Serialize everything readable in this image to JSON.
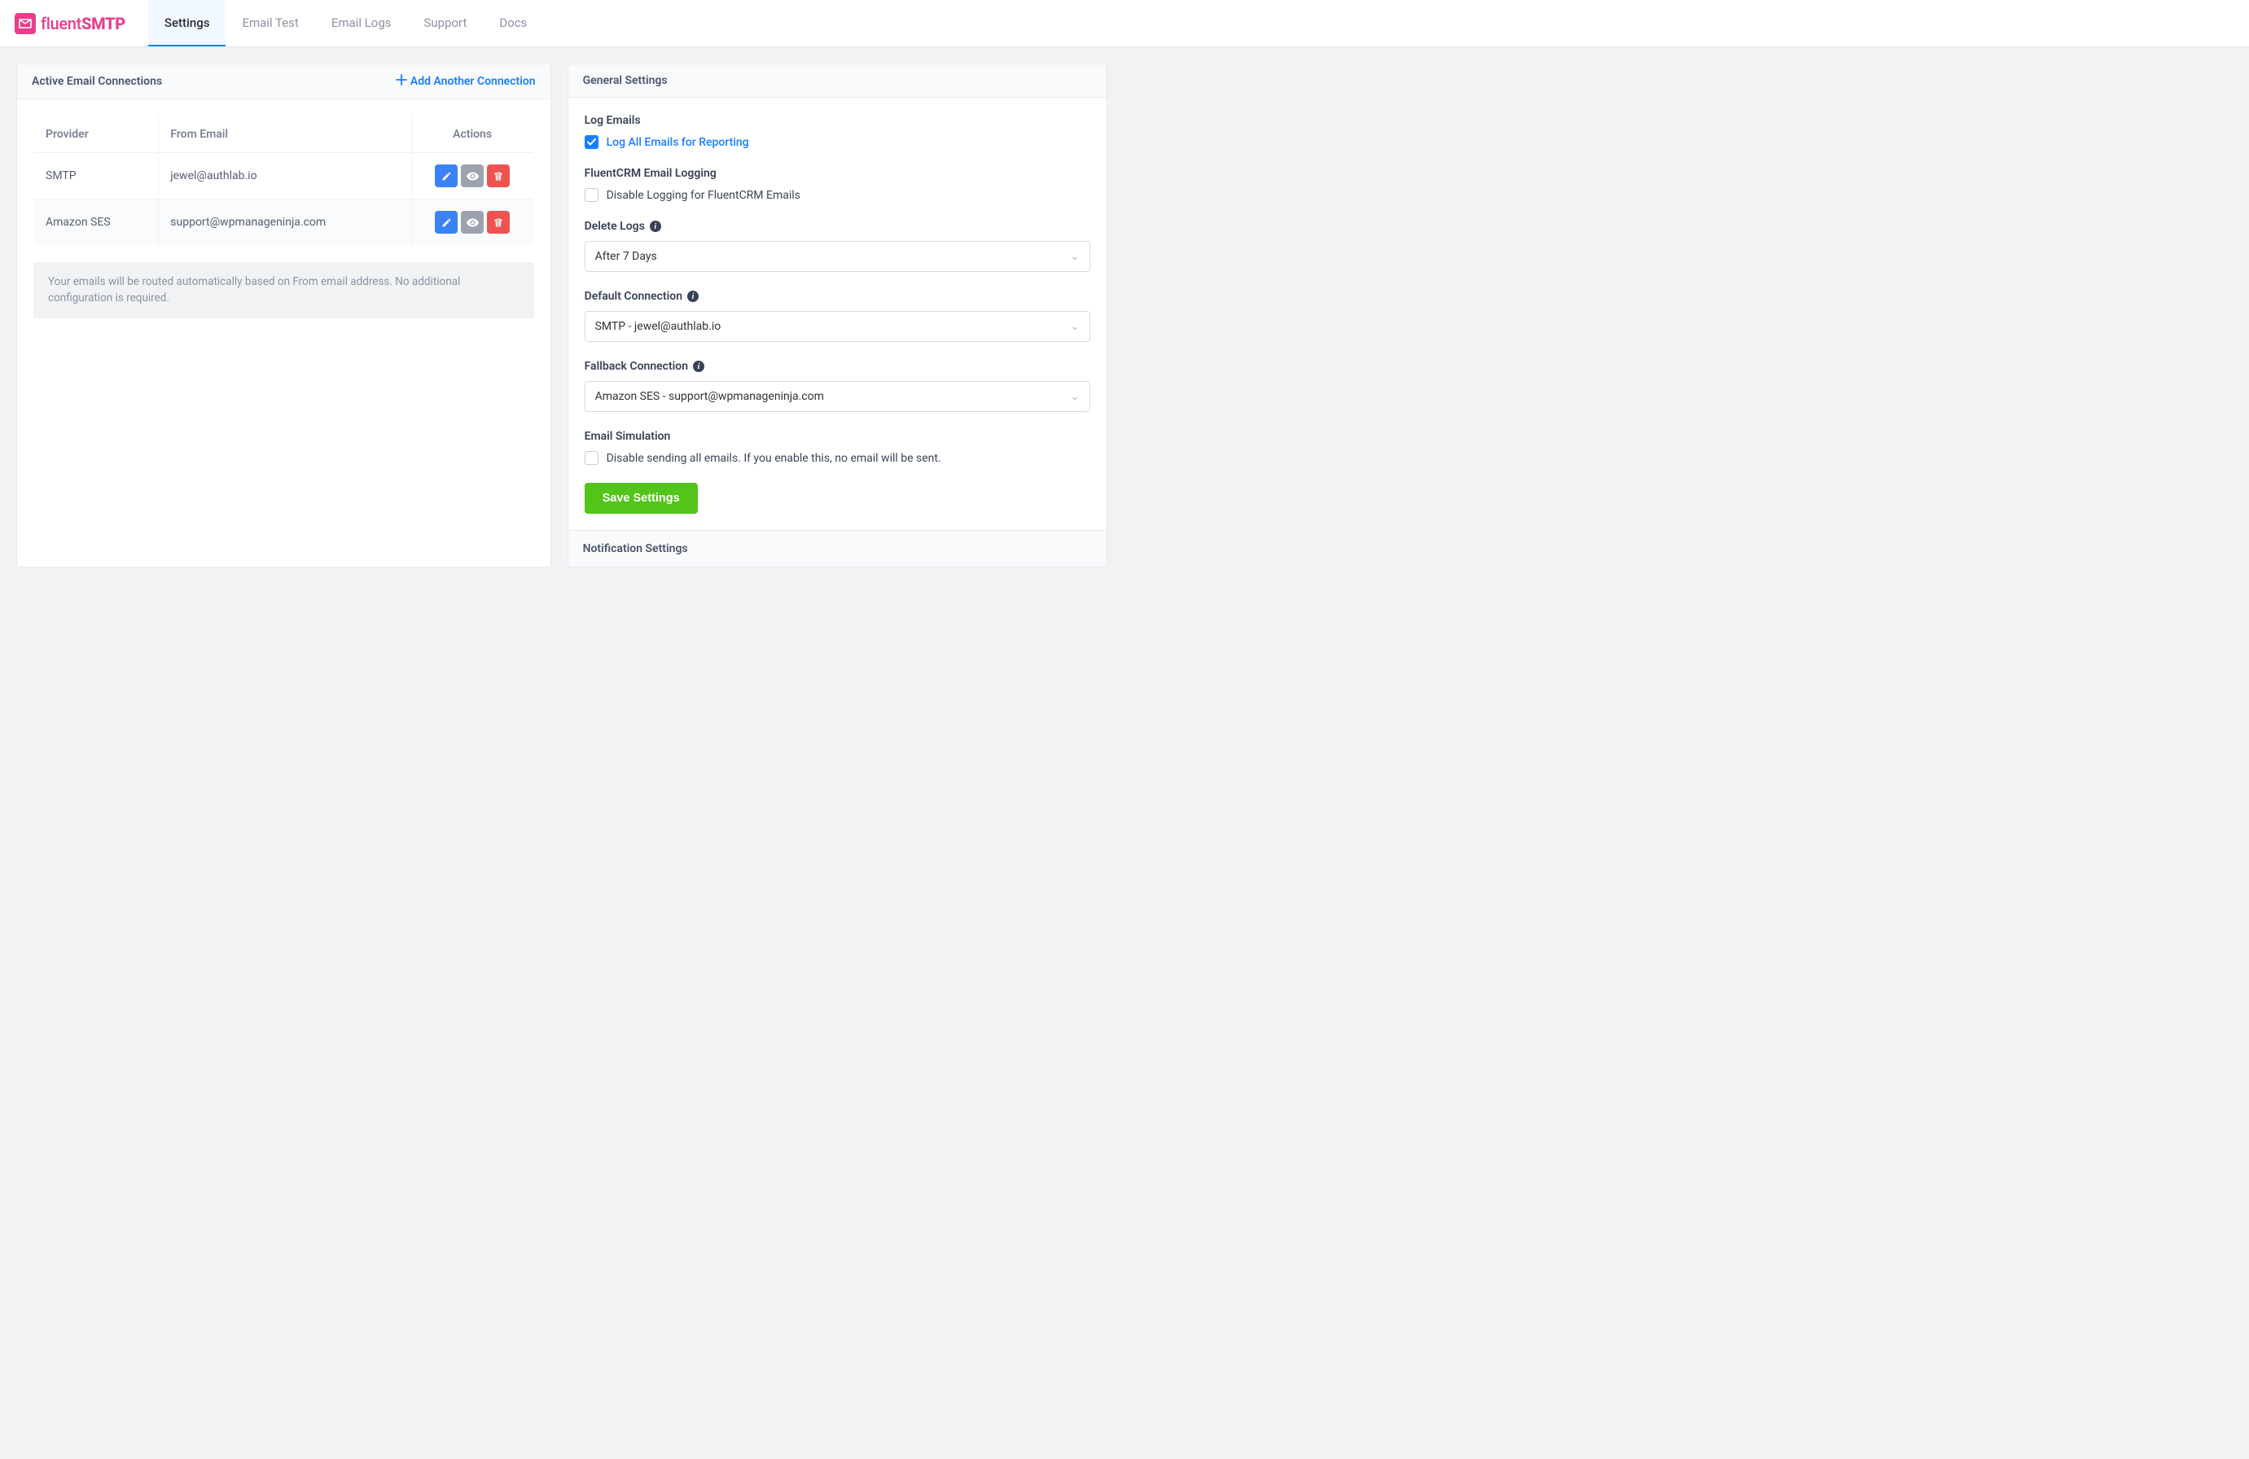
{
  "brand": {
    "name1": "fluent",
    "name2": "SMTP"
  },
  "nav": {
    "tabs": [
      {
        "label": "Settings",
        "active": true
      },
      {
        "label": "Email Test",
        "active": false
      },
      {
        "label": "Email Logs",
        "active": false
      },
      {
        "label": "Support",
        "active": false
      },
      {
        "label": "Docs",
        "active": false
      }
    ]
  },
  "left": {
    "title": "Active Email Connections",
    "add_label": "Add Another Connection",
    "columns": {
      "provider": "Provider",
      "from": "From Email",
      "actions": "Actions"
    },
    "rows": [
      {
        "provider": "SMTP",
        "from": "jewel@authlab.io"
      },
      {
        "provider": "Amazon SES",
        "from": "support@wpmanageninja.com"
      }
    ],
    "hint": "Your emails will be routed automatically based on From email address. No additional configuration is required."
  },
  "right": {
    "title": "General Settings",
    "log_emails": {
      "title": "Log Emails",
      "check_label": "Log All Emails for Reporting",
      "checked": true
    },
    "fluentcrm": {
      "title": "FluentCRM Email Logging",
      "check_label": "Disable Logging for FluentCRM Emails",
      "checked": false
    },
    "delete_logs": {
      "title": "Delete Logs",
      "value": "After 7 Days"
    },
    "default_conn": {
      "title": "Default Connection",
      "value": "SMTP - jewel@authlab.io"
    },
    "fallback_conn": {
      "title": "Fallback Connection",
      "value": "Amazon SES - support@wpmanageninja.com"
    },
    "simulation": {
      "title": "Email Simulation",
      "check_label": "Disable sending all emails. If you enable this, no email will be sent.",
      "checked": false
    },
    "save_label": "Save Settings",
    "notification_title": "Notification Settings"
  }
}
